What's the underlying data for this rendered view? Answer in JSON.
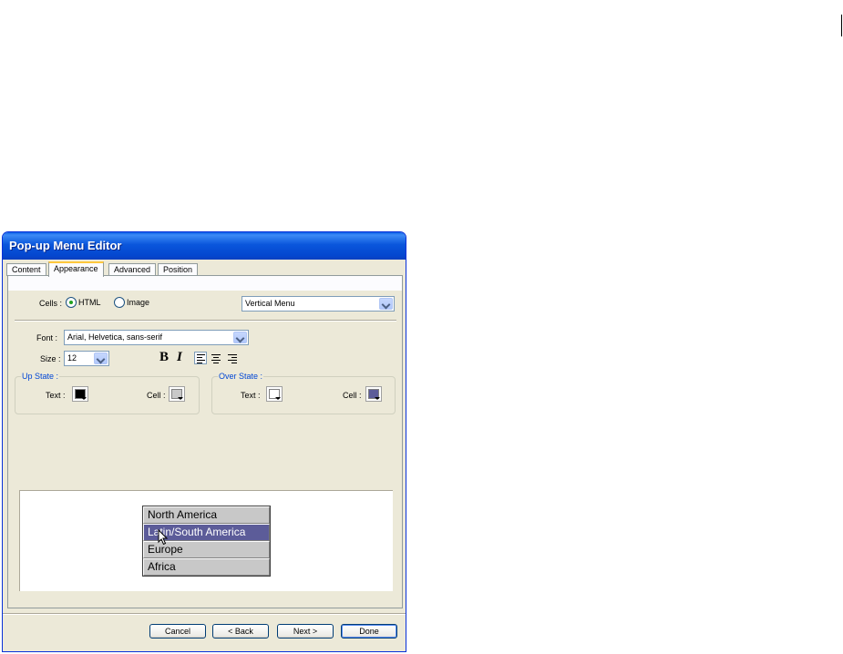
{
  "window": {
    "title": "Pop-up Menu Editor",
    "tabs": [
      "Content",
      "Appearance",
      "Advanced",
      "Position"
    ],
    "active_tab": "Appearance"
  },
  "cells": {
    "label": "Cells :",
    "options": [
      "HTML",
      "Image"
    ],
    "selected": "HTML",
    "orientation": "Vertical Menu"
  },
  "font": {
    "label": "Font :",
    "value": "Arial, Helvetica, sans-serif",
    "size_label": "Size :",
    "size_value": "12",
    "bold": "B",
    "italic": "I"
  },
  "up_state": {
    "title": "Up State :",
    "text_label": "Text :",
    "text_color": "#000000",
    "cell_label": "Cell :",
    "cell_color": "#c8c8c8"
  },
  "over_state": {
    "title": "Over State :",
    "text_label": "Text :",
    "text_color": "#ffffff",
    "cell_label": "Cell :",
    "cell_color": "#5c5c99"
  },
  "preview": {
    "items": [
      "North America",
      "Latin/South America",
      "Europe",
      "Africa"
    ],
    "hover_index": 1
  },
  "buttons": {
    "cancel": "Cancel",
    "back": "< Back",
    "next": "Next >",
    "done": "Done"
  }
}
